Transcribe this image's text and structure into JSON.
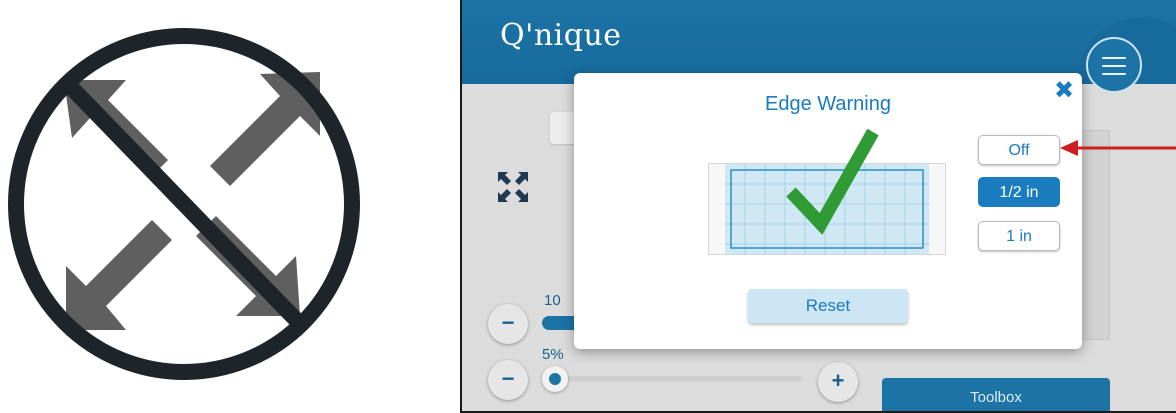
{
  "app": {
    "logo_text": "Q'nique",
    "brand_color": "#1c73a6",
    "accent_color": "#1a7bbf"
  },
  "background_controls": {
    "value_label_top": "10",
    "value_label_bottom": "5%",
    "minus_label": "−",
    "plus_label": "+",
    "toolbox_label": "Toolbox",
    "zoom_slider_fraction": 0.05
  },
  "dialog": {
    "title": "Edge Warning",
    "close_icon": "close-icon",
    "options": [
      {
        "label": "Off",
        "selected": false
      },
      {
        "label": "1/2 in",
        "selected": true
      },
      {
        "label": "1 in",
        "selected": false
      }
    ],
    "reset_label": "Reset",
    "check_color": "#2e9b35"
  },
  "annotations": {
    "arrow_color": "#cc1f1f",
    "no_sign_color": "#1d242a",
    "arrow_icon_color": "#5f5f5f"
  }
}
